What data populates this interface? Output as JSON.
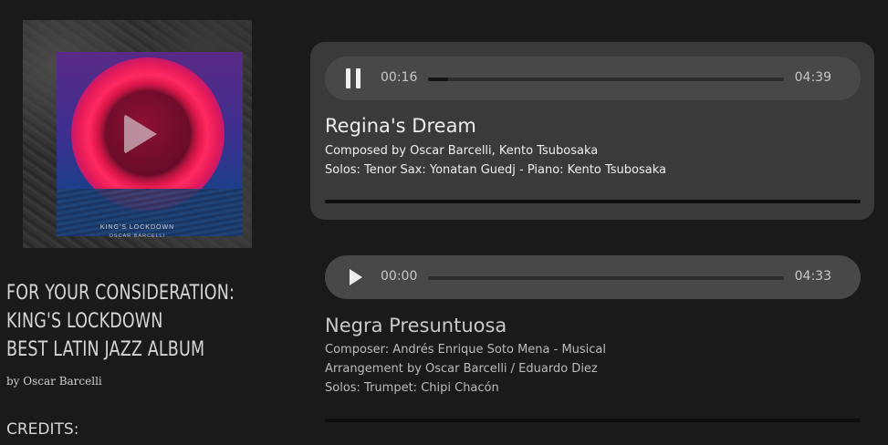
{
  "album": {
    "art_title": "KING'S LOCKDOWN",
    "art_artist": "OSCAR BARCELLI",
    "play_icon": "play-icon"
  },
  "promo": {
    "line1": "FOR YOUR CONSIDERATION:",
    "line2": "KING'S LOCKDOWN",
    "line3": "BEST LATIN JAZZ ALBUM"
  },
  "byline": "by Oscar Barcelli",
  "credits_label": "CREDITS:",
  "tracks": [
    {
      "title": "Regina's Dream",
      "state": "playing",
      "button_icon": "pause-icon",
      "current_time": "00:16",
      "duration": "04:39",
      "progress": 0.057,
      "lines": [
        "Composed by Oscar Barcelli, Kento Tsubosaka",
        "Solos: Tenor Sax: Yonatan Guedj - Piano: Kento Tsubosaka"
      ]
    },
    {
      "title": "Negra Presuntuosa",
      "state": "paused",
      "button_icon": "play-icon",
      "current_time": "00:00",
      "duration": "04:33",
      "progress": 0,
      "lines": [
        "Composer: Andrés Enrique Soto Mena - Musical",
        "Arrangement by Oscar Barcelli / Eduardo Diez",
        "Solos: Trumpet: Chipi Chacón"
      ]
    }
  ]
}
